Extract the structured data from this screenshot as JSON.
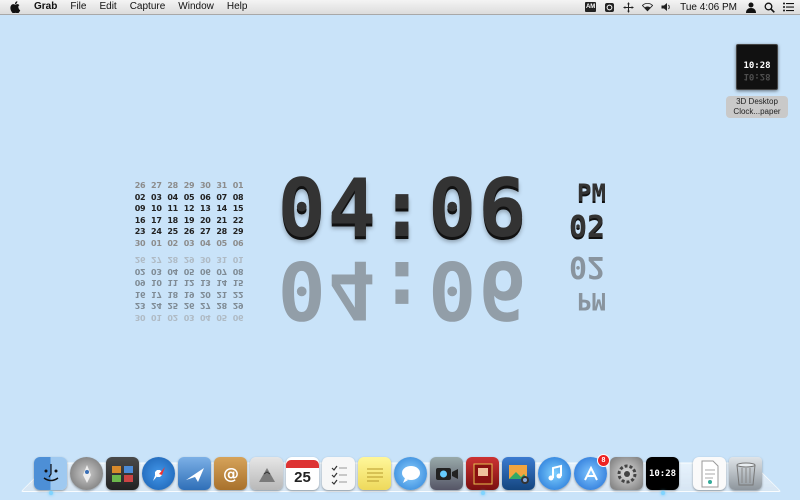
{
  "menubar": {
    "app_name": "Grab",
    "menus": [
      "File",
      "Edit",
      "Capture",
      "Window",
      "Help"
    ],
    "status": {
      "badge_text": "AM",
      "clock": "Tue 4:06 PM"
    }
  },
  "desktop_file": {
    "label": "3D Desktop Clock...paper",
    "thumb_time": "10:28"
  },
  "calendar": {
    "rows": [
      {
        "days": [
          "26",
          "27",
          "28",
          "29",
          "30",
          "31",
          "01"
        ],
        "dim": true
      },
      {
        "days": [
          "02",
          "03",
          "04",
          "05",
          "06",
          "07",
          "08"
        ],
        "dim": false
      },
      {
        "days": [
          "09",
          "10",
          "11",
          "12",
          "13",
          "14",
          "15"
        ],
        "dim": false
      },
      {
        "days": [
          "16",
          "17",
          "18",
          "19",
          "20",
          "21",
          "22"
        ],
        "dim": false
      },
      {
        "days": [
          "23",
          "24",
          "25",
          "26",
          "27",
          "28",
          "29"
        ],
        "dim": false
      },
      {
        "days": [
          "30",
          "01",
          "02",
          "03",
          "04",
          "05",
          "06"
        ],
        "dim": true
      }
    ]
  },
  "clock": {
    "time": "04:06",
    "ampm": "PM",
    "day": "02"
  },
  "dock": {
    "calendar_day": "25",
    "appstore_badge": "8",
    "clock_time": "10:28",
    "apps": [
      "finder",
      "launchpad",
      "mission-control",
      "safari",
      "mail",
      "contacts",
      "image-capture",
      "calendar",
      "reminders",
      "notes",
      "messages",
      "facetime",
      "photo-booth",
      "iphoto",
      "itunes",
      "app-store",
      "system-preferences",
      "3d-desktop-clock"
    ]
  },
  "colors": {
    "desktop": "#c9e3f9",
    "clock_text": "#333333"
  }
}
